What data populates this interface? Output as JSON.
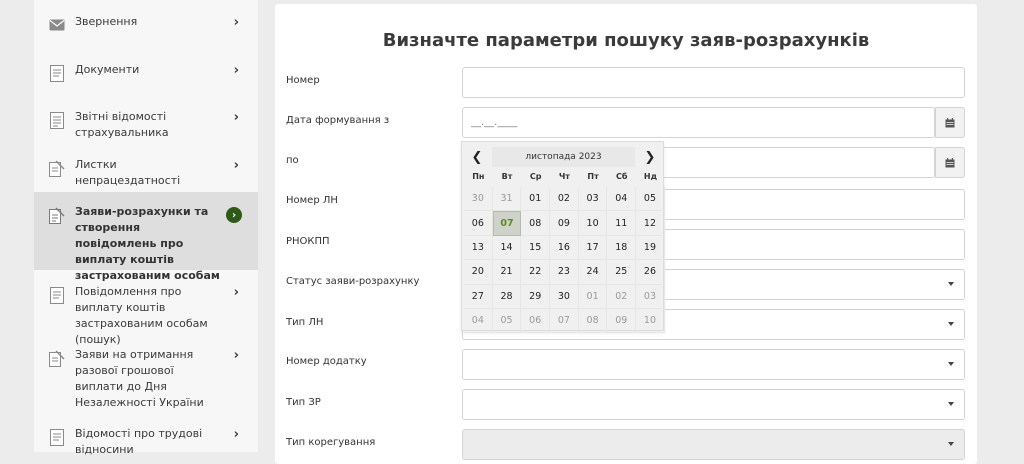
{
  "sidebar": {
    "items": [
      {
        "label": "Звернення",
        "icon": "envelope-icon"
      },
      {
        "label": "Документи",
        "icon": "document-icon"
      },
      {
        "label": "Звітні відомості страхувальника",
        "icon": "report-icon"
      },
      {
        "label": "Листки непрацездатності",
        "icon": "sheet-icon"
      },
      {
        "label": "Заяви-розрахунки та створення повідомлень про виплату коштів застрахованим особам",
        "icon": "calculation-icon",
        "active": true
      },
      {
        "label": "Повідомлення про виплату коштів застрахованим особам (пошук)",
        "icon": "notice-icon"
      },
      {
        "label": "Заяви на отримання разової грошової виплати до Дня Незалежності України",
        "icon": "application-icon"
      },
      {
        "label": "Відомості про трудові відносини",
        "icon": "labor-icon"
      }
    ]
  },
  "form": {
    "title": "Визначте параметри пошуку заяв-розрахунків",
    "fields": {
      "number": {
        "label": "Номер",
        "value": ""
      },
      "date_from": {
        "label": "Дата формування з",
        "placeholder": "__.__.____"
      },
      "date_to": {
        "label": "по",
        "value": ""
      },
      "ln_number": {
        "label": "Номер ЛН",
        "value": ""
      },
      "rnokpp": {
        "label": "РНОКПП",
        "value": ""
      },
      "status": {
        "label": "Статус заяви-розрахунку",
        "value": ""
      },
      "ln_type": {
        "label": "Тип ЛН",
        "value": ""
      },
      "attachment_number": {
        "label": "Номер додатку",
        "value": ""
      },
      "zr_type": {
        "label": "Тип ЗР",
        "value": ""
      },
      "correction_type": {
        "label": "Тип корегування",
        "value": ""
      }
    }
  },
  "datepicker": {
    "month_label": "листопада 2023",
    "prev_label": "❮",
    "next_label": "❯",
    "weekdays": [
      "Пн",
      "Вт",
      "Ср",
      "Чт",
      "Пт",
      "Сб",
      "Нд"
    ],
    "today": "07",
    "days": [
      {
        "d": "30",
        "muted": true
      },
      {
        "d": "31",
        "muted": true
      },
      {
        "d": "01"
      },
      {
        "d": "02"
      },
      {
        "d": "03"
      },
      {
        "d": "04"
      },
      {
        "d": "05"
      },
      {
        "d": "06"
      },
      {
        "d": "07",
        "today": true
      },
      {
        "d": "08"
      },
      {
        "d": "09"
      },
      {
        "d": "10"
      },
      {
        "d": "11"
      },
      {
        "d": "12"
      },
      {
        "d": "13"
      },
      {
        "d": "14"
      },
      {
        "d": "15"
      },
      {
        "d": "16"
      },
      {
        "d": "17"
      },
      {
        "d": "18"
      },
      {
        "d": "19"
      },
      {
        "d": "20"
      },
      {
        "d": "21"
      },
      {
        "d": "22"
      },
      {
        "d": "23"
      },
      {
        "d": "24"
      },
      {
        "d": "25"
      },
      {
        "d": "26"
      },
      {
        "d": "27"
      },
      {
        "d": "28"
      },
      {
        "d": "29"
      },
      {
        "d": "30"
      },
      {
        "d": "01",
        "muted": true
      },
      {
        "d": "02",
        "muted": true
      },
      {
        "d": "03",
        "muted": true
      },
      {
        "d": "04",
        "muted": true
      },
      {
        "d": "05",
        "muted": true
      },
      {
        "d": "06",
        "muted": true
      },
      {
        "d": "07",
        "muted": true
      },
      {
        "d": "08",
        "muted": true
      },
      {
        "d": "09",
        "muted": true
      },
      {
        "d": "10",
        "muted": true
      }
    ]
  },
  "colors": {
    "accent": "#2e5a17",
    "today_text": "#5b8a2a",
    "page_bg": "#ececec"
  }
}
